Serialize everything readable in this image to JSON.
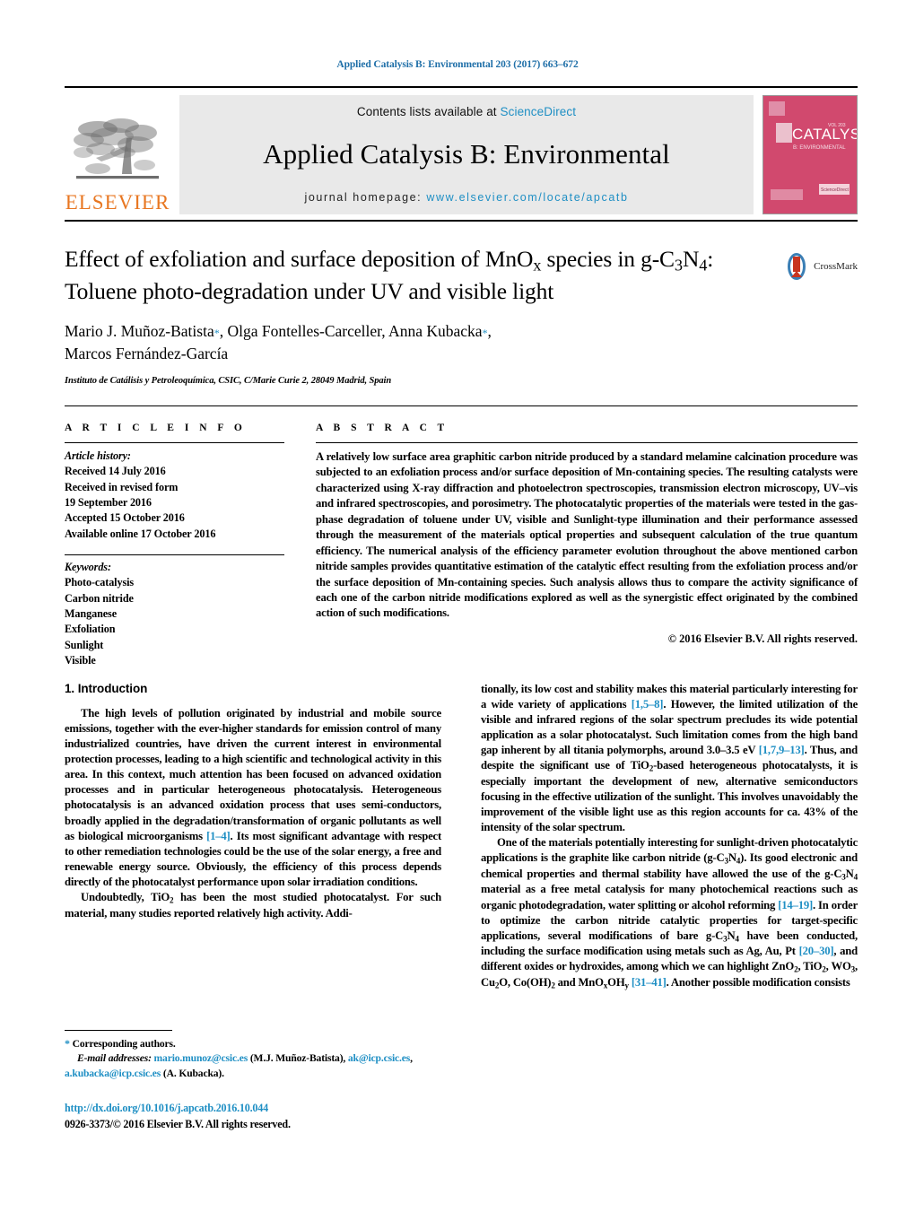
{
  "running_head": "Applied Catalysis B: Environmental 203 (2017) 663–672",
  "masthead": {
    "contents_prefix": "Contents lists available at ",
    "sciencedirect": "ScienceDirect",
    "journal_title": "Applied Catalysis B: Environmental",
    "homepage_prefix": "journal homepage: ",
    "homepage_url": "www.elsevier.com/locate/apcatb",
    "publisher": "ELSEVIER",
    "cover_word": "CATALYSIS",
    "cover_sub": "B: ENVIRONMENTAL",
    "link_color": "#1f8fc4",
    "publisher_color": "#E87722",
    "cover_color": "#d1496e"
  },
  "article": {
    "title_line1": "Effect of exfoliation and surface deposition of MnO",
    "title_line1_sub": "x",
    "title_line1_mid": " species in g-C",
    "title_line1_sub2": "3",
    "title_line1_mid2": "N",
    "title_line1_sub3": "4",
    "title_line1_end": ":",
    "title_line2": "Toluene photo-degradation under UV and visible light",
    "authors_line1": "Mario J. Muñoz-Batista",
    "authors_line1b": ", Olga Fontelles-Carceller, Anna Kubacka",
    "authors_line1c": ",",
    "authors_line2": "Marcos Fernández-García",
    "affiliation": "Instituto de Catálisis y Petroleoquímica, CSIC, C/Marie Curie 2, 28049 Madrid, Spain",
    "crossmark_label": "CrossMark"
  },
  "article_info": {
    "heading": "A R T I C L E   I N F O",
    "history_label": "Article history:",
    "history": [
      "Received 14 July 2016",
      "Received in revised form",
      "19 September 2016",
      "Accepted 15 October 2016",
      "Available online 17 October 2016"
    ],
    "keywords_label": "Keywords:",
    "keywords": [
      "Photo-catalysis",
      "Carbon nitride",
      "Manganese",
      "Exfoliation",
      "Sunlight",
      "Visible"
    ]
  },
  "abstract": {
    "heading": "A B S T R A C T",
    "text": "A relatively low surface area graphitic carbon nitride produced by a standard melamine calcination procedure was subjected to an exfoliation process and/or surface deposition of Mn-containing species. The resulting catalysts were characterized using X-ray diffraction and photoelectron spectroscopies, transmission electron microscopy, UV–vis and infrared spectroscopies, and porosimetry. The photocatalytic properties of the materials were tested in the gas-phase degradation of toluene under UV, visible and Sunlight-type illumination and their performance assessed through the measurement of the materials optical properties and subsequent calculation of the true quantum efficiency. The numerical analysis of the efficiency parameter evolution throughout the above mentioned carbon nitride samples provides quantitative estimation of the catalytic effect resulting from the exfoliation process and/or the surface deposition of Mn-containing species. Such analysis allows thus to compare the activity significance of each one of the carbon nitride modifications explored as well as the synergistic effect originated by the combined action of such modifications.",
    "copyright": "© 2016 Elsevier B.V. All rights reserved."
  },
  "body": {
    "section_title": "1. Introduction",
    "left_para1_a": "The high levels of pollution originated by industrial and mobile source emissions, together with the ever-higher standards for emission control of many industrialized countries, have driven the current interest in environmental protection processes, leading to a high scientific and technological activity in this area. In this context, much attention has been focused on advanced oxidation processes and in particular heterogeneous photocatalysis. Heterogeneous photocatalysis is an advanced oxidation process that uses semi-conductors, broadly applied in the degradation/transformation of organic pollutants as well as biological microorganisms ",
    "left_para1_ref": "[1–4]",
    "left_para1_b": ". Its most significant advantage with respect to other remediation technologies could be the use of the solar energy, a free and renewable energy source. Obviously, the efficiency of this process depends directly of the photocatalyst performance upon solar irradiation conditions.",
    "left_para2": "Undoubtedly, TiO2 has been the most studied photocatalyst. For such material, many studies reported relatively high activity. Addi-",
    "right_para1_a": "tionally, its low cost and stability makes this material particularly interesting for a wide variety of applications ",
    "right_para1_ref1": "[1,5–8]",
    "right_para1_b": ". However, the limited utilization of the visible and infrared regions of the solar spectrum precludes its wide potential application as a solar photocatalyst. Such limitation comes from the high band gap inherent by all titania polymorphs, around 3.0–3.5 eV ",
    "right_para1_ref2": "[1,7,9–13]",
    "right_para1_c": ". Thus, and despite the significant use of TiO2-based heterogeneous photocatalysts, it is especially important the development of new, alternative semiconductors focusing in the effective utilization of the sunlight. This involves unavoidably the improvement of the visible light use as this region accounts for ca. 43% of the intensity of the solar spectrum.",
    "right_para2_a": "One of the materials potentially interesting for sunlight-driven photocatalytic applications is the graphite like carbon nitride (g-C3N4). Its good electronic and chemical properties and thermal stability have allowed the use of the g-C3N4 material as a free metal catalysis for many photochemical reactions such as organic photodegradation, water splitting or alcohol reforming ",
    "right_para2_ref1": "[14–19]",
    "right_para2_b": ". In order to optimize the carbon nitride catalytic properties for target-specific applications, several modifications of bare g-C3N4 have been conducted, including the surface modification using metals such as Ag, Au, Pt ",
    "right_para2_ref2": "[20–30]",
    "right_para2_c": ", and different oxides or hydroxides, among which we can highlight ZnO2, TiO2, WO3, Cu2O, Co(OH)2 and MnOxOHy ",
    "right_para2_ref3": "[31–41]",
    "right_para2_d": ". Another possible modification consists"
  },
  "footnotes": {
    "corresponding": "Corresponding authors.",
    "email_label": "E-mail addresses:",
    "email1": "mario.munoz@csic.es",
    "email1_name": " (M.J. Muñoz-Batista), ",
    "email2": "ak@icp.csic.es",
    "email2_sep": ", ",
    "email3": "a.kubacka@icp.csic.es",
    "email3_name": " (A. Kubacka)."
  },
  "doi": {
    "url": "http://dx.doi.org/10.1016/j.apcatb.2016.10.044",
    "issn_line": "0926-3373/© 2016 Elsevier B.V. All rights reserved."
  }
}
